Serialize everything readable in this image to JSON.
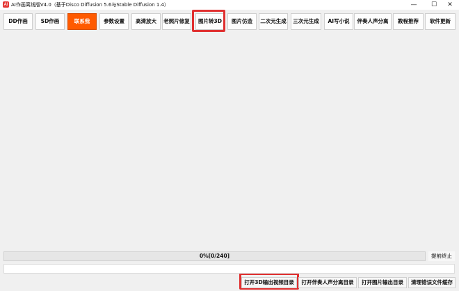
{
  "window": {
    "icon_glyph": "AI",
    "title": "AI作画离线版V4.0（基于Disco Diffusion 5.6与Stable Diffusion 1.4）",
    "minimize_glyph": "—",
    "maximize_glyph": "☐",
    "close_glyph": "✕"
  },
  "toolbar": {
    "dd_label": "DD作画",
    "sd_label": "SD作画",
    "contact_label": "联系我",
    "params_label": "参数设置",
    "upscale_label": "高清放大",
    "restore_label": "老照片修复",
    "to3d_label": "图片转3D",
    "imitate_label": "图片仿造",
    "anime2d_label": "二次元生成",
    "render3d_label": "三次元生成",
    "novel_label": "AI写小说",
    "separate_label": "伴奏人声分离",
    "tutorial_label": "教程推荐",
    "update_label": "软件更新"
  },
  "progress": {
    "text": "0%[0/240]",
    "value": 0
  },
  "stop_button": "提前终止",
  "log_text": "",
  "bottom_buttons": {
    "open_3d_dir": "打开3D输出视频目录",
    "open_separate_dir": "打开伴奏人声分离目录",
    "open_image_dir": "打开图片输出目录",
    "clear_cache": "清理错误文件缓存"
  },
  "colors": {
    "active_button": "#ff5a00",
    "highlight_border": "#e03030",
    "background": "#f0f0f0"
  }
}
